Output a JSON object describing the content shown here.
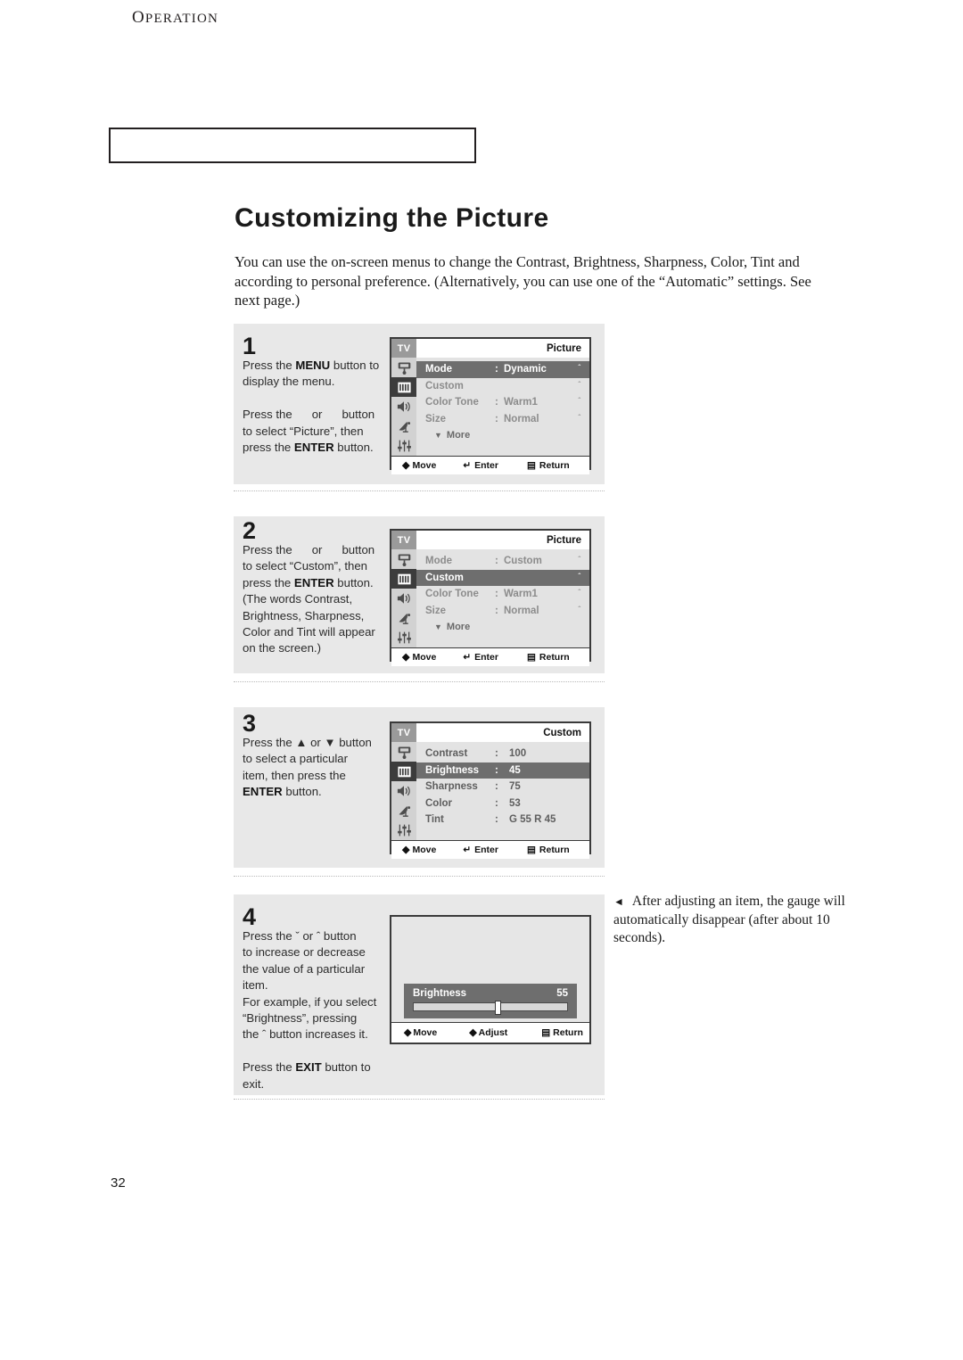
{
  "header": {
    "chapter_initial": "O",
    "chapter_rest": "PERATION"
  },
  "page": {
    "title": "Customizing the Picture",
    "intro": "You can use the on-screen menus to change the Contrast, Brightness, Sharpness, Color, Tint and  according to personal preference. (Alternatively, you can use one of the “Automatic” settings. See next page.)",
    "number": "32"
  },
  "colors": {
    "panel_bg": "#e8e8e8",
    "osd_bg": "#e3e3e3",
    "osd_highlight": "#6e6e6e",
    "osd_icon_rail": "#d2d2d2",
    "osd_icon_active": "#3c3c3c",
    "border": "#3a3a3a",
    "text": "#1a1a1a"
  },
  "osd_footer": {
    "move": "Move",
    "enter": "Enter",
    "return": "Return",
    "adjust": "Adjust"
  },
  "osd_icons": [
    {
      "name": "input-source-icon",
      "active": false
    },
    {
      "name": "picture-icon",
      "active": true
    },
    {
      "name": "speaker-icon",
      "active": false
    },
    {
      "name": "satellite-dish-icon",
      "active": false
    },
    {
      "name": "setup-sliders-icon",
      "active": false
    }
  ],
  "steps": [
    {
      "number": "1",
      "lines": [
        [
          {
            "t": "Press the ",
            "b": false
          },
          {
            "t": "MENU",
            "b": true
          },
          {
            "t": " button to",
            "b": false
          }
        ],
        [
          {
            "t": "display the menu.",
            "b": false
          }
        ],
        [
          {
            "t": "",
            "b": false
          }
        ],
        [
          {
            "t": "Press the",
            "b": false
          },
          {
            "t": "GAP"
          },
          {
            "t": "or",
            "b": false
          },
          {
            "t": "GAP"
          },
          {
            "t": "button",
            "b": false
          }
        ],
        [
          {
            "t": "to select “Picture”, then",
            "b": false
          }
        ],
        [
          {
            "t": "press the ",
            "b": false
          },
          {
            "t": "ENTER",
            "b": true
          },
          {
            "t": " button.",
            "b": false
          }
        ]
      ],
      "osd": {
        "tv_label": "TV",
        "title": "Picture",
        "rows": [
          {
            "label": "Mode",
            "colon": ":",
            "value": "Dynamic",
            "selected": true,
            "arrow": "ˆ"
          },
          {
            "label": "Custom",
            "colon": "",
            "value": "",
            "selected": false,
            "arrow": "ˆ"
          },
          {
            "label": "Color Tone",
            "colon": ":",
            "value": "Warm1",
            "selected": false,
            "arrow": "ˆ"
          },
          {
            "label": "Size",
            "colon": ":",
            "value": "Normal",
            "selected": false,
            "arrow": "ˆ"
          }
        ],
        "more": "More"
      }
    },
    {
      "number": "2",
      "lines": [
        [
          {
            "t": "Press the",
            "b": false
          },
          {
            "t": "GAP"
          },
          {
            "t": "or",
            "b": false
          },
          {
            "t": "GAP"
          },
          {
            "t": "button",
            "b": false
          }
        ],
        [
          {
            "t": "to select “Custom”, then",
            "b": false
          }
        ],
        [
          {
            "t": "press the ",
            "b": false
          },
          {
            "t": "ENTER",
            "b": true
          },
          {
            "t": " button.",
            "b": false
          }
        ],
        [
          {
            "t": "(The words Contrast,",
            "b": false
          }
        ],
        [
          {
            "t": "Brightness, Sharpness,",
            "b": false
          }
        ],
        [
          {
            "t": "Color and Tint will appear",
            "b": false
          }
        ],
        [
          {
            "t": "on the screen.)",
            "b": false
          }
        ]
      ],
      "osd": {
        "tv_label": "TV",
        "title": "Picture",
        "rows": [
          {
            "label": "Mode",
            "colon": ":",
            "value": "Custom",
            "selected": false,
            "arrow": "ˆ"
          },
          {
            "label": "Custom",
            "colon": "",
            "value": "",
            "selected": true,
            "arrow": "ˆ"
          },
          {
            "label": "Color Tone",
            "colon": ":",
            "value": "Warm1",
            "selected": false,
            "arrow": "ˆ"
          },
          {
            "label": "Size",
            "colon": ":",
            "value": "Normal",
            "selected": false,
            "arrow": "ˆ"
          }
        ],
        "more": "More"
      }
    },
    {
      "number": "3",
      "lines": [
        [
          {
            "t": "Press the ",
            "b": false
          },
          {
            "t": "▲",
            "b": false
          },
          {
            "t": " or ",
            "b": false
          },
          {
            "t": "▼",
            "b": false
          },
          {
            "t": " button",
            "b": false
          }
        ],
        [
          {
            "t": "to select a particular",
            "b": false
          }
        ],
        [
          {
            "t": "item, then press the",
            "b": false
          }
        ],
        [
          {
            "t": "ENTER",
            "b": true
          },
          {
            "t": " button.",
            "b": false
          }
        ]
      ],
      "osd": {
        "tv_label": "TV",
        "title": "Custom",
        "rows": [
          {
            "label": "Contrast",
            "colon": ":",
            "value": "100",
            "selected": false,
            "arrow": ""
          },
          {
            "label": "Brightness",
            "colon": ":",
            "value": "45",
            "selected": true,
            "arrow": ""
          },
          {
            "label": "Sharpness",
            "colon": ":",
            "value": "75",
            "selected": false,
            "arrow": ""
          },
          {
            "label": "Color",
            "colon": ":",
            "value": "53",
            "selected": false,
            "arrow": ""
          },
          {
            "label": "Tint",
            "colon": ":",
            "value": "G 55  R 45",
            "selected": false,
            "arrow": ""
          }
        ],
        "more": ""
      }
    },
    {
      "number": "4",
      "lines": [
        [
          {
            "t": "Press the ",
            "b": false
          },
          {
            "t": "ˇ",
            "b": false
          },
          {
            "t": "  or ",
            "b": false
          },
          {
            "t": "ˆ",
            "b": false
          },
          {
            "t": "  button",
            "b": false
          }
        ],
        [
          {
            "t": "to increase or decrease",
            "b": false
          }
        ],
        [
          {
            "t": "the value of a particular",
            "b": false
          }
        ],
        [
          {
            "t": "item.",
            "b": false
          }
        ],
        [
          {
            "t": "For example, if you select",
            "b": false
          }
        ],
        [
          {
            "t": "“Brightness”, pressing",
            "b": false
          }
        ],
        [
          {
            "t": "the ",
            "b": false
          },
          {
            "t": "ˆ",
            "b": false
          },
          {
            "t": "  button increases it.",
            "b": false
          }
        ],
        [
          {
            "t": "",
            "b": false
          }
        ],
        [
          {
            "t": "Press the ",
            "b": false
          },
          {
            "t": "EXIT",
            "b": true
          },
          {
            "t": " button to",
            "b": false
          }
        ],
        [
          {
            "t": "exit.",
            "b": false
          }
        ]
      ],
      "gauge": {
        "label": "Brightness",
        "value": "55",
        "percent": 55
      }
    }
  ],
  "side_note": {
    "marker": "◄",
    "text": "After adjusting an item, the gauge will automatically disappear (after about 10 seconds)."
  }
}
